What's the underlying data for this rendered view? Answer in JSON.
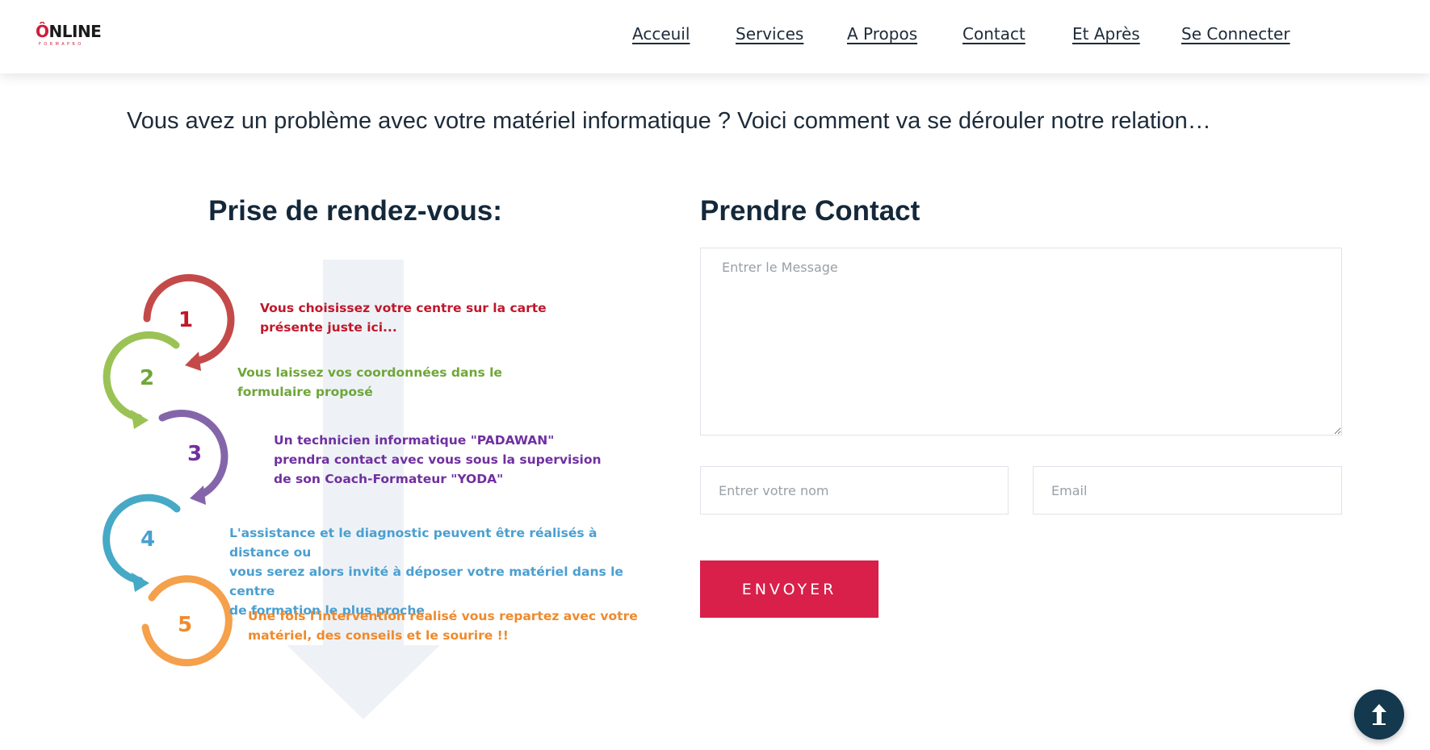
{
  "brand": {
    "logo_text": "NLINE",
    "logo_o": "Ô",
    "logo_sub": "FORMAPRO"
  },
  "nav": {
    "items": [
      "Acceuil",
      "Services",
      "A Propos",
      "Contact",
      "Et Après",
      "Se Connecter"
    ]
  },
  "headline": "Vous avez un problème avec votre matériel informatique ? Voici comment va se dérouler notre relation…",
  "appointment": {
    "title": "Prise de rendez-vous:",
    "steps": [
      {
        "num": "1",
        "color": "#c0172b",
        "arc_color": "#c44a4a",
        "lines": [
          "Vous choisissez votre centre sur la carte",
          "présente juste ici..."
        ]
      },
      {
        "num": "2",
        "color": "#6fa639",
        "arc_color": "#9bc255",
        "lines": [
          "Vous laissez vos coordonnées dans le",
          "formulaire proposé"
        ]
      },
      {
        "num": "3",
        "color": "#7030a0",
        "arc_color": "#8465aa",
        "lines": [
          "Un technicien informatique \"PADAWAN\"",
          "prendra contact avec vous sous la supervision",
          "de son Coach-Formateur \"YODA\""
        ]
      },
      {
        "num": "4",
        "color": "#4a9fd0",
        "arc_color": "#46a9c6",
        "lines": [
          "L'assistance et le diagnostic peuvent être réalisés à distance ou",
          "vous serez alors invité à déposer votre matériel dans le centre",
          "de formation le plus proche"
        ]
      },
      {
        "num": "5",
        "color": "#ef8a2c",
        "arc_color": "#f5a04a",
        "lines": [
          "Une fois l'intervention réalisé vous repartez avec votre",
          "matériel, des conseils et le sourire !!"
        ]
      }
    ]
  },
  "contact": {
    "title": "Prendre Contact",
    "message_placeholder": "Entrer le Message",
    "name_placeholder": "Entrer votre nom",
    "email_placeholder": "Email",
    "submit_label": "ENVOYER",
    "submit_color": "#d8204a"
  },
  "back_to_top": {
    "icon": "arrow-up-icon"
  }
}
